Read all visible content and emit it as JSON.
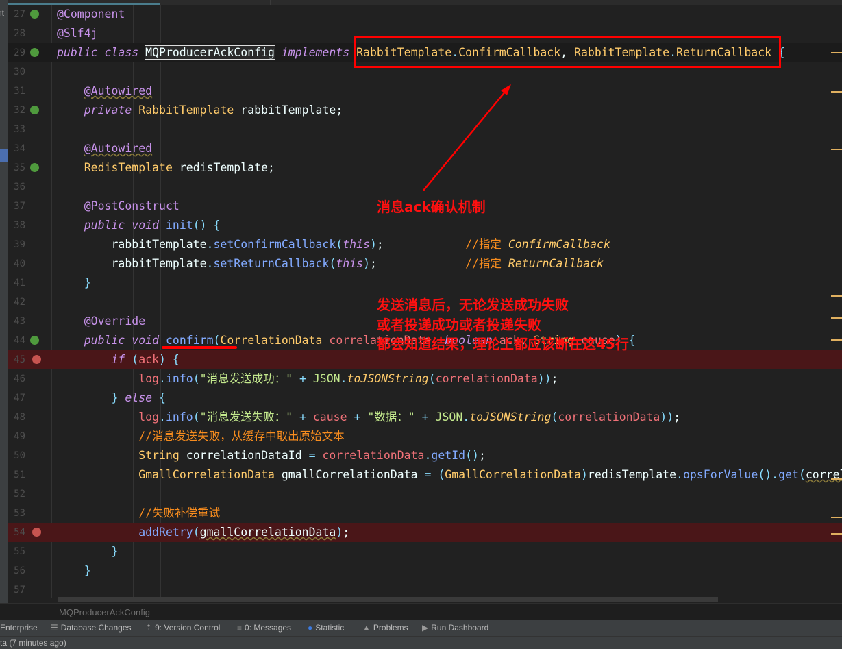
{
  "left_strip_text": "nt",
  "breadcrumb": "MQProducerAckConfig",
  "status_text": "ta (7 minutes ago)",
  "tool_windows": [
    {
      "label": "Enterprise",
      "icon": "enterprise-icon"
    },
    {
      "label": "Database Changes",
      "icon": "database-icon"
    },
    {
      "label": "9: Version Control",
      "icon": "version-control-icon"
    },
    {
      "label": "0: Messages",
      "icon": "messages-icon"
    },
    {
      "label": "Statistic",
      "icon": "statistic-icon"
    },
    {
      "label": "Problems",
      "icon": "warning-icon"
    },
    {
      "label": "Run Dashboard",
      "icon": "run-icon"
    }
  ],
  "annotations": {
    "box_note": "消息ack确认机制",
    "confirm_note": [
      "发送消息后，无论发送成功失败",
      "或者投递成功或者投递失败",
      "都会知道结果，理论上都应该断在这45行"
    ],
    "color": "#ff0000"
  },
  "colors": {
    "background": "#212121",
    "keyword": "#C792EA",
    "class": "#FFCB6B",
    "method": "#82AAFF",
    "string": "#C3E88D",
    "comment": "#F78C1E",
    "breakpoint_line": "#4a1618"
  },
  "lines": [
    {
      "n": "27",
      "icon": "bean",
      "t": [
        [
          "an",
          "@Component"
        ]
      ]
    },
    {
      "n": "28",
      "t": [
        [
          "an",
          "@Slf4j"
        ]
      ]
    },
    {
      "n": "29",
      "icon": "bean",
      "cur": true,
      "t": [
        [
          "kw",
          "public class "
        ],
        [
          "tx box",
          "MQProducerAckConfig"
        ],
        [
          "tx",
          " "
        ],
        [
          "kw",
          "implements "
        ],
        [
          "cls",
          "RabbitTemplate"
        ],
        [
          "op",
          "."
        ],
        [
          "cls",
          "ConfirmCallback"
        ],
        [
          "tx",
          ", "
        ],
        [
          "cls",
          "RabbitTemplate"
        ],
        [
          "op",
          "."
        ],
        [
          "cls",
          "ReturnCallback"
        ],
        [
          "tx",
          " "
        ],
        [
          "op",
          "{"
        ]
      ]
    },
    {
      "n": "30",
      "t": []
    },
    {
      "n": "31",
      "t": [
        [
          "tx",
          "    "
        ],
        [
          "an und",
          "@Autowired"
        ]
      ]
    },
    {
      "n": "32",
      "icon": "bean",
      "t": [
        [
          "tx",
          "    "
        ],
        [
          "kw",
          "private "
        ],
        [
          "cls",
          "RabbitTemplate "
        ],
        [
          "tx",
          "rabbitTemplate;"
        ]
      ]
    },
    {
      "n": "33",
      "t": []
    },
    {
      "n": "34",
      "t": [
        [
          "tx",
          "    "
        ],
        [
          "an und",
          "@Autowired"
        ]
      ]
    },
    {
      "n": "35",
      "icon": "bean",
      "t": [
        [
          "tx",
          "    "
        ],
        [
          "cls",
          "RedisTemplate "
        ],
        [
          "tx",
          "redisTemplate;"
        ]
      ]
    },
    {
      "n": "36",
      "t": []
    },
    {
      "n": "37",
      "t": [
        [
          "tx",
          "    "
        ],
        [
          "an",
          "@PostConstruct"
        ]
      ]
    },
    {
      "n": "38",
      "t": [
        [
          "tx",
          "    "
        ],
        [
          "kw",
          "public void "
        ],
        [
          "fn",
          "init"
        ],
        [
          "op",
          "() {"
        ]
      ]
    },
    {
      "n": "39",
      "t": [
        [
          "tx",
          "        rabbitTemplate"
        ],
        [
          "op",
          "."
        ],
        [
          "fn",
          "setConfirmCallback"
        ],
        [
          "op",
          "("
        ],
        [
          "kw",
          "this"
        ],
        [
          "op",
          ")"
        ],
        [
          "tx",
          ";            "
        ],
        [
          "cm",
          "//指定 "
        ],
        [
          "cm sit",
          "ConfirmCallback"
        ]
      ]
    },
    {
      "n": "40",
      "t": [
        [
          "tx",
          "        rabbitTemplate"
        ],
        [
          "op",
          "."
        ],
        [
          "fn",
          "setReturnCallback"
        ],
        [
          "op",
          "("
        ],
        [
          "kw",
          "this"
        ],
        [
          "op",
          ")"
        ],
        [
          "tx",
          ";             "
        ],
        [
          "cm",
          "//指定 "
        ],
        [
          "cm sit",
          "ReturnCallback"
        ]
      ]
    },
    {
      "n": "41",
      "t": [
        [
          "tx",
          "    "
        ],
        [
          "op",
          "}"
        ]
      ]
    },
    {
      "n": "42",
      "t": []
    },
    {
      "n": "43",
      "t": [
        [
          "tx",
          "    "
        ],
        [
          "an",
          "@Override"
        ]
      ]
    },
    {
      "n": "44",
      "icon": "bean",
      "t": [
        [
          "tx",
          "    "
        ],
        [
          "kw",
          "public void "
        ],
        [
          "fn",
          "confirm"
        ],
        [
          "op",
          "("
        ],
        [
          "cls",
          "CorrelationData "
        ],
        [
          "par",
          "correlationData"
        ],
        [
          "tx",
          ", "
        ],
        [
          "kw",
          "boolean "
        ],
        [
          "par",
          "ack"
        ],
        [
          "tx",
          ", "
        ],
        [
          "cls",
          "String "
        ],
        [
          "par",
          "cause"
        ],
        [
          "op",
          ") {"
        ]
      ]
    },
    {
      "n": "45",
      "bp": true,
      "t": [
        [
          "tx",
          "        "
        ],
        [
          "kw",
          "if "
        ],
        [
          "op",
          "("
        ],
        [
          "par",
          "ack"
        ],
        [
          "op",
          ") {"
        ]
      ]
    },
    {
      "n": "46",
      "t": [
        [
          "tx",
          "            "
        ],
        [
          "par",
          "log"
        ],
        [
          "op",
          "."
        ],
        [
          "fn",
          "info"
        ],
        [
          "op",
          "("
        ],
        [
          "str",
          "\"消息发送成功：\""
        ],
        [
          "op",
          " + "
        ],
        [
          "jsn",
          "JSON"
        ],
        [
          "op",
          "."
        ],
        [
          "sit",
          "toJSONString"
        ],
        [
          "op",
          "("
        ],
        [
          "par",
          "correlationData"
        ],
        [
          "op",
          "))"
        ],
        [
          "tx",
          ";"
        ]
      ]
    },
    {
      "n": "47",
      "t": [
        [
          "tx",
          "        "
        ],
        [
          "op",
          "} "
        ],
        [
          "kw",
          "else "
        ],
        [
          "op",
          "{"
        ]
      ]
    },
    {
      "n": "48",
      "t": [
        [
          "tx",
          "            "
        ],
        [
          "par",
          "log"
        ],
        [
          "op",
          "."
        ],
        [
          "fn",
          "info"
        ],
        [
          "op",
          "("
        ],
        [
          "str",
          "\"消息发送失败：\""
        ],
        [
          "op",
          " + "
        ],
        [
          "par",
          "cause"
        ],
        [
          "op",
          " + "
        ],
        [
          "str",
          "\"数据：\""
        ],
        [
          "op",
          " + "
        ],
        [
          "jsn",
          "JSON"
        ],
        [
          "op",
          "."
        ],
        [
          "sit",
          "toJSONString"
        ],
        [
          "op",
          "("
        ],
        [
          "par",
          "correlationData"
        ],
        [
          "op",
          "))"
        ],
        [
          "tx",
          ";"
        ]
      ]
    },
    {
      "n": "49",
      "t": [
        [
          "tx",
          "            "
        ],
        [
          "cm",
          "//消息发送失败，从缓存中取出原始文本"
        ]
      ]
    },
    {
      "n": "50",
      "t": [
        [
          "tx",
          "            "
        ],
        [
          "cls",
          "String "
        ],
        [
          "tx",
          "correlationDataId "
        ],
        [
          "op",
          "= "
        ],
        [
          "par",
          "correlationData"
        ],
        [
          "op",
          "."
        ],
        [
          "fn",
          "getId"
        ],
        [
          "op",
          "()"
        ],
        [
          "tx",
          ";"
        ]
      ]
    },
    {
      "n": "51",
      "t": [
        [
          "tx",
          "            "
        ],
        [
          "cls",
          "GmallCorrelationData "
        ],
        [
          "tx",
          "gmallCorrelationData "
        ],
        [
          "op",
          "= ("
        ],
        [
          "cls",
          "GmallCorrelationData"
        ],
        [
          "op",
          ")"
        ],
        [
          "tx",
          "redisTemplate"
        ],
        [
          "op",
          "."
        ],
        [
          "fn",
          "opsForValue"
        ],
        [
          "op",
          "()."
        ],
        [
          "fn",
          "get"
        ],
        [
          "op",
          "("
        ],
        [
          "tx und",
          "correlationDataId"
        ],
        [
          "op",
          ")"
        ],
        [
          "tx",
          ";"
        ]
      ]
    },
    {
      "n": "52",
      "t": []
    },
    {
      "n": "53",
      "t": [
        [
          "tx",
          "            "
        ],
        [
          "cm",
          "//失败补偿重试"
        ]
      ]
    },
    {
      "n": "54",
      "bp": true,
      "t": [
        [
          "tx",
          "            "
        ],
        [
          "fn",
          "addRetry"
        ],
        [
          "op",
          "("
        ],
        [
          "tx und",
          "gmallCorrelationData"
        ],
        [
          "op",
          ")"
        ],
        [
          "tx",
          ";"
        ]
      ]
    },
    {
      "n": "55",
      "t": [
        [
          "tx",
          "        "
        ],
        [
          "op",
          "}"
        ]
      ]
    },
    {
      "n": "56",
      "t": [
        [
          "tx",
          "    "
        ],
        [
          "op",
          "}"
        ]
      ]
    },
    {
      "n": "57",
      "t": []
    }
  ]
}
